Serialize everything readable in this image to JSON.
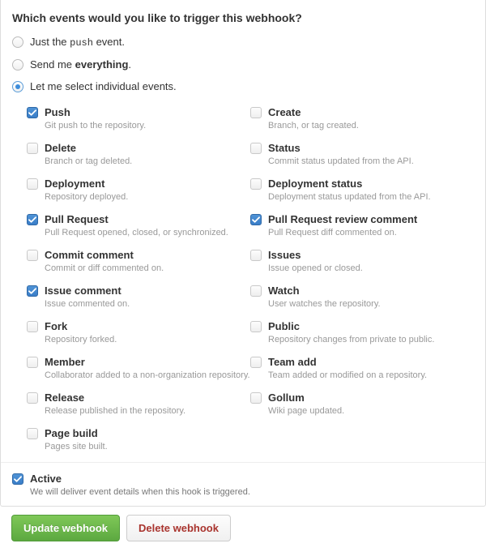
{
  "heading": "Which events would you like to trigger this webhook?",
  "radios": {
    "just_push_pre": "Just the ",
    "just_push_code": "push",
    "just_push_post": " event.",
    "send_pre": "Send me ",
    "send_bold": "everything",
    "send_post": ".",
    "individual": "Let me select individual events."
  },
  "events_left": [
    {
      "label": "Push",
      "desc": "Git push to the repository.",
      "checked": true
    },
    {
      "label": "Delete",
      "desc": "Branch or tag deleted.",
      "checked": false
    },
    {
      "label": "Deployment",
      "desc": "Repository deployed.",
      "checked": false
    },
    {
      "label": "Pull Request",
      "desc": "Pull Request opened, closed, or synchronized.",
      "checked": true
    },
    {
      "label": "Commit comment",
      "desc": "Commit or diff commented on.",
      "checked": false
    },
    {
      "label": "Issue comment",
      "desc": "Issue commented on.",
      "checked": true
    },
    {
      "label": "Fork",
      "desc": "Repository forked.",
      "checked": false
    },
    {
      "label": "Member",
      "desc": "Collaborator added to a non-organization repository.",
      "checked": false
    },
    {
      "label": "Release",
      "desc": "Release published in the repository.",
      "checked": false
    },
    {
      "label": "Page build",
      "desc": "Pages site built.",
      "checked": false
    }
  ],
  "events_right": [
    {
      "label": "Create",
      "desc": "Branch, or tag created.",
      "checked": false
    },
    {
      "label": "Status",
      "desc": "Commit status updated from the API.",
      "checked": false
    },
    {
      "label": "Deployment status",
      "desc": "Deployment status updated from the API.",
      "checked": false
    },
    {
      "label": "Pull Request review comment",
      "desc": "Pull Request diff commented on.",
      "checked": true
    },
    {
      "label": "Issues",
      "desc": "Issue opened or closed.",
      "checked": false
    },
    {
      "label": "Watch",
      "desc": "User watches the repository.",
      "checked": false
    },
    {
      "label": "Public",
      "desc": "Repository changes from private to public.",
      "checked": false
    },
    {
      "label": "Team add",
      "desc": "Team added or modified on a repository.",
      "checked": false
    },
    {
      "label": "Gollum",
      "desc": "Wiki page updated.",
      "checked": false
    }
  ],
  "active": {
    "label": "Active",
    "desc": "We will deliver event details when this hook is triggered.",
    "checked": true
  },
  "buttons": {
    "update": "Update webhook",
    "delete": "Delete webhook"
  }
}
